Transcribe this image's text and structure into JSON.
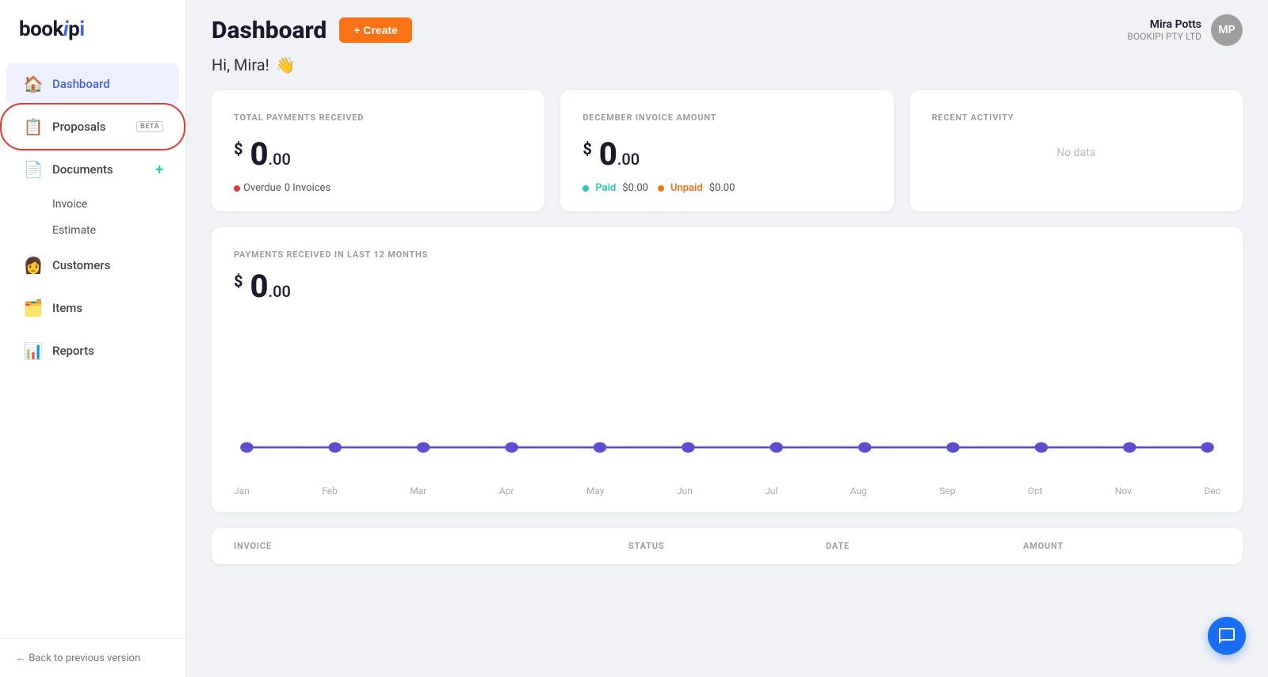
{
  "app": {
    "name": "bookipi",
    "logo_highlight": "ipi"
  },
  "sidebar": {
    "nav_items": [
      {
        "id": "dashboard",
        "label": "Dashboard",
        "icon": "🏠",
        "active": true
      },
      {
        "id": "proposals",
        "label": "Proposals",
        "icon": "📋",
        "badge": "BETA",
        "highlighted": true
      },
      {
        "id": "documents",
        "label": "Documents",
        "icon": "📄",
        "has_add": true
      },
      {
        "id": "invoice",
        "label": "Invoice",
        "sub": true
      },
      {
        "id": "estimate",
        "label": "Estimate",
        "sub": true
      },
      {
        "id": "customers",
        "label": "Customers",
        "icon": "👩"
      },
      {
        "id": "items",
        "label": "Items",
        "icon": "🗂️"
      },
      {
        "id": "reports",
        "label": "Reports",
        "icon": "📊"
      }
    ],
    "footer": {
      "back_label": "← Back to previous version"
    }
  },
  "header": {
    "title": "Dashboard",
    "create_label": "+ Create",
    "user": {
      "name": "Mira Potts",
      "company": "BOOKIPI PTY LTD",
      "initials": "MP"
    }
  },
  "greeting": {
    "text": "Hi, Mira!",
    "emoji": "👋"
  },
  "cards": {
    "total_payments": {
      "title": "TOTAL PAYMENTS RECEIVED",
      "amount_dollar": "$",
      "amount_whole": "0",
      "amount_cents": ".00",
      "overdue_label": "Overdue",
      "overdue_value": "0 Invoices"
    },
    "december_invoice": {
      "title": "DECEMBER INVOICE AMOUNT",
      "amount_dollar": "$",
      "amount_whole": "0",
      "amount_cents": ".00",
      "paid_label": "Paid",
      "paid_value": "$0.00",
      "unpaid_label": "Unpaid",
      "unpaid_value": "$0.00"
    },
    "recent_activity": {
      "title": "RECENT ACTIVITY",
      "empty_label": "No data"
    }
  },
  "chart": {
    "title": "PAYMENTS RECEIVED IN LAST 12 MONTHS",
    "amount_dollar": "$",
    "amount_whole": "0",
    "amount_cents": ".00",
    "labels": [
      "Jan",
      "Feb",
      "Mar",
      "Apr",
      "May",
      "Jun",
      "Jul",
      "Aug",
      "Sep",
      "Oct",
      "Nov",
      "Dec"
    ],
    "values": [
      0,
      0,
      0,
      0,
      0,
      0,
      0,
      0,
      0,
      0,
      0,
      0
    ],
    "line_color": "#5b4fcf"
  },
  "invoice_table": {
    "columns": [
      "INVOICE",
      "STATUS",
      "DATE",
      "AMOUNT"
    ]
  }
}
